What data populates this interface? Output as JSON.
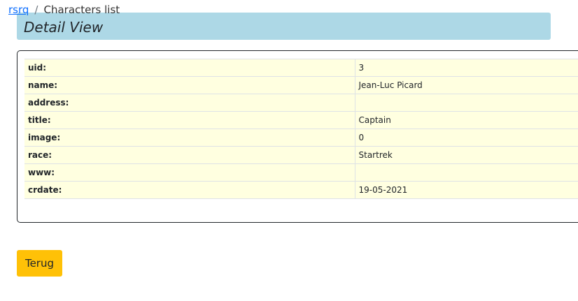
{
  "breadcrumb": {
    "home_link": "rsrq",
    "separator": "/",
    "current": "Characters list"
  },
  "header": {
    "title": "Detail View"
  },
  "detail": {
    "rows": [
      {
        "key": "uid:",
        "value": "3"
      },
      {
        "key": "name:",
        "value": "Jean-Luc Picard"
      },
      {
        "key": "address:",
        "value": ""
      },
      {
        "key": "title:",
        "value": "Captain"
      },
      {
        "key": "image:",
        "value": "0"
      },
      {
        "key": "race:",
        "value": "Startrek"
      },
      {
        "key": "www:",
        "value": ""
      },
      {
        "key": "crdate:",
        "value": "19-05-2021"
      }
    ]
  },
  "actions": {
    "back_label": "Terug"
  },
  "colors": {
    "header_background": "#add8e6",
    "table_background": "#ffffe0",
    "button_background": "#ffc107",
    "link": "#0d6efd"
  }
}
